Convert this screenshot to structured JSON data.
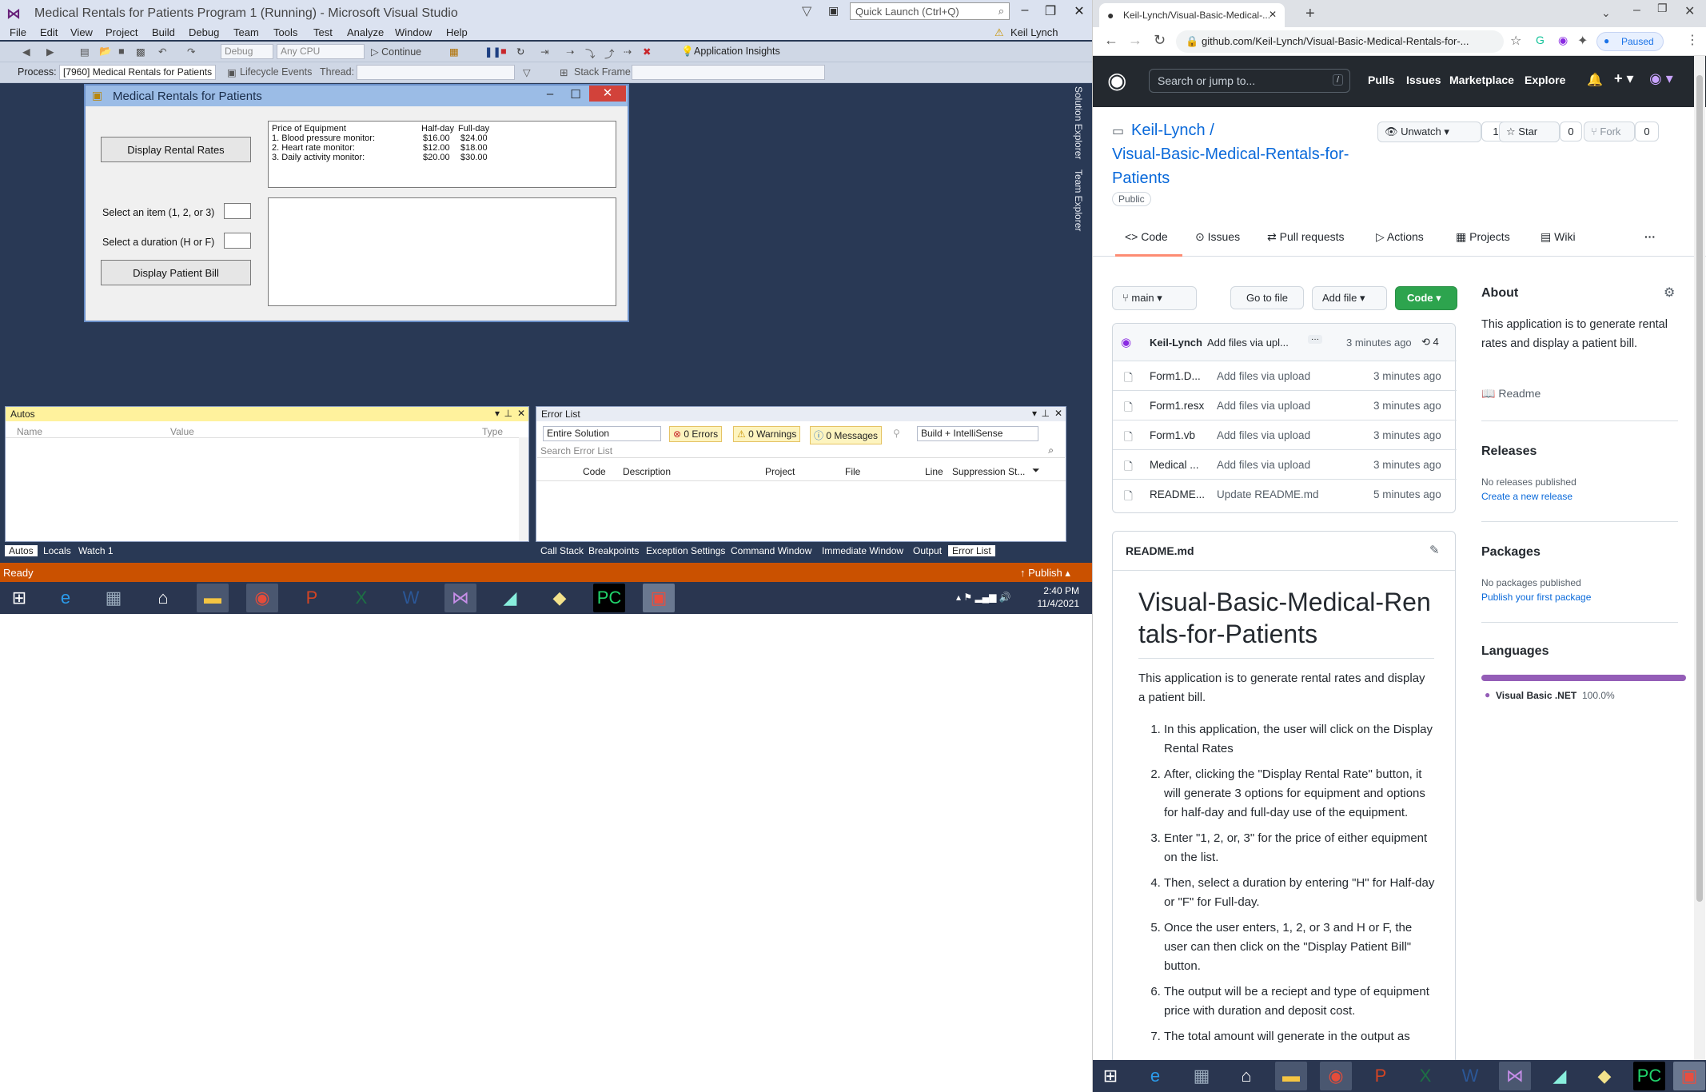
{
  "vs": {
    "title": "Medical Rentals for Patients Program 1 (Running) - Microsoft Visual Studio",
    "quick_launch_placeholder": "Quick Launch (Ctrl+Q)",
    "user": "Keil Lynch",
    "menu": [
      "File",
      "Edit",
      "View",
      "Project",
      "Build",
      "Debug",
      "Team",
      "Tools",
      "Test",
      "Analyze",
      "Window",
      "Help"
    ],
    "toolbar": {
      "config": "Debug",
      "platform": "Any CPU",
      "continue": "Continue",
      "insights": "Application Insights"
    },
    "toolbar2": {
      "process_label": "Process:",
      "process_value": "[7960] Medical Rentals for Patients",
      "lifecycle": "Lifecycle Events",
      "thread": "Thread:",
      "stack": "Stack Frame:"
    },
    "side_tabs": [
      "Solution Explorer",
      "Team Explorer"
    ],
    "status": {
      "text": "Ready",
      "publish": "Publish"
    }
  },
  "form": {
    "title": "Medical Rentals for Patients",
    "display_rates_btn": "Display Rental Rates",
    "select_item_label": "Select an item (1, 2, or 3)",
    "select_duration_label": "Select a duration (H or F)",
    "display_bill_btn": "Display Patient Bill",
    "list_header": {
      "col1": "Price of Equipment",
      "col2": "Half-day",
      "col3": "Full-day"
    },
    "list_rows": [
      {
        "name": "1. Blood pressure monitor:",
        "half": "$16.00",
        "full": "$24.00"
      },
      {
        "name": "2. Heart rate monitor:",
        "half": "$12.00",
        "full": "$18.00"
      },
      {
        "name": "3. Daily activity monitor:",
        "half": "$20.00",
        "full": "$30.00"
      }
    ]
  },
  "autos": {
    "title": "Autos",
    "columns": [
      "Name",
      "Value",
      "Type"
    ],
    "tabs": [
      "Autos",
      "Locals",
      "Watch 1"
    ]
  },
  "errors": {
    "title": "Error List",
    "scope": "Entire Solution",
    "errors": "0 Errors",
    "warnings": "0 Warnings",
    "messages": "0 Messages",
    "build": "Build + IntelliSense",
    "search_placeholder": "Search Error List",
    "columns": [
      "Code",
      "Description",
      "Project",
      "File",
      "Line",
      "Suppression St..."
    ],
    "tabs": [
      "Call Stack",
      "Breakpoints",
      "Exception Settings",
      "Command Window",
      "Immediate Window",
      "Output",
      "Error List"
    ]
  },
  "tray": {
    "time": "2:40 PM",
    "date": "11/4/2021"
  },
  "chrome": {
    "tab_title": "Keil-Lynch/Visual-Basic-Medical-...",
    "url": "github.com/Keil-Lynch/Visual-Basic-Medical-Rentals-for-...",
    "paused": "Paused"
  },
  "github": {
    "search": "Search or jump to...",
    "nav": [
      "Pulls",
      "Issues",
      "Marketplace",
      "Explore"
    ],
    "owner": "Keil-Lynch /",
    "repo_line1": "Visual-Basic-Medical-Rentals-for-",
    "repo_line2": "Patients",
    "visibility": "Public",
    "unwatch": "Unwatch",
    "unwatch_count": "1",
    "star": "Star",
    "star_count": "0",
    "fork": "Fork",
    "fork_count": "0",
    "tabs": [
      "Code",
      "Issues",
      "Pull requests",
      "Actions",
      "Projects",
      "Wiki"
    ],
    "branch": "main",
    "goto": "Go to file",
    "addfile": "Add file",
    "code": "Code",
    "commit": {
      "author": "Keil-Lynch",
      "msg": "Add files via upl...",
      "time": "3 minutes ago",
      "count": "4"
    },
    "files": [
      {
        "name": "Form1.D...",
        "msg": "Add files via upload",
        "time": "3 minutes ago"
      },
      {
        "name": "Form1.resx",
        "msg": "Add files via upload",
        "time": "3 minutes ago"
      },
      {
        "name": "Form1.vb",
        "msg": "Add files via upload",
        "time": "3 minutes ago"
      },
      {
        "name": "Medical ...",
        "msg": "Add files via upload",
        "time": "3 minutes ago"
      },
      {
        "name": "README...",
        "msg": "Update README.md",
        "time": "5 minutes ago"
      }
    ],
    "readme_label": "README.md",
    "readme_title": "Visual-Basic-Medical-Rentals-for-Patients",
    "readme_intro": "This application is to generate rental rates and display a patient bill.",
    "readme_steps": [
      "In this application, the user will click on the Display Rental Rates",
      "After, clicking the \"Display Rental Rate\" button, it will generate 3 options for equipment and options for half-day and full-day use of the equipment.",
      "Enter \"1, 2, or, 3\" for the price of either equipment on the list.",
      "Then, select a duration by entering \"H\" for Half-day or \"F\" for Full-day.",
      "Once the user enters, 1, 2, or 3 and H or F, the user can then click on the \"Display Patient Bill\" button.",
      "The output will be a reciept and type of equipment price with duration and deposit cost.",
      "The total amount will generate in the output as"
    ],
    "about": {
      "title": "About",
      "desc": "This application is to generate rental rates and display a patient bill.",
      "readme": "Readme"
    },
    "releases": {
      "title": "Releases",
      "none": "No releases published",
      "link": "Create a new release"
    },
    "packages": {
      "title": "Packages",
      "none": "No packages published",
      "link": "Publish your first package"
    },
    "languages": {
      "title": "Languages",
      "name": "Visual Basic .NET",
      "pct": "100.0%"
    }
  },
  "colors": {
    "vs_bg": "#293955",
    "vs_status": "#ca5100",
    "gh_green": "#2da44e",
    "gh_header": "#24292f",
    "lang_vb": "#945db7"
  }
}
